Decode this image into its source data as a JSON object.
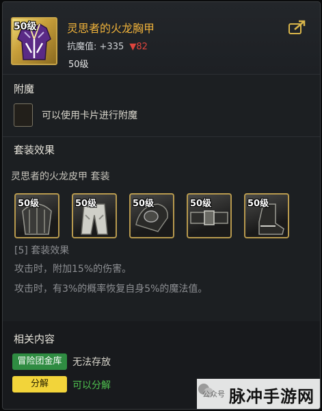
{
  "item": {
    "level_badge": "50级",
    "name": "灵思者的火龙胸甲",
    "stat_label": "抗魔值:",
    "stat_value": "+335",
    "stat_change": "▼82",
    "level": "50级"
  },
  "enchant": {
    "title": "附魔",
    "text": "可以使用卡片进行附魔"
  },
  "set": {
    "title": "套装效果",
    "name": "灵思者的火龙皮甲  套装",
    "pieces": [
      {
        "level": "50级",
        "icon": "helmet-icon"
      },
      {
        "level": "50级",
        "icon": "pants-icon"
      },
      {
        "level": "50级",
        "icon": "shoulder-icon"
      },
      {
        "level": "50级",
        "icon": "belt-icon"
      },
      {
        "level": "50级",
        "icon": "boots-icon"
      }
    ],
    "effect_header": "[5] 套装效果",
    "effects": [
      "攻击时，附加15%的伤害。",
      "攻击时，有3%的概率恢复自身5%的魔法值。"
    ]
  },
  "related": {
    "title": "相关内容",
    "rows": [
      {
        "tag": "冒险团金库",
        "text": "无法存放",
        "tag_color": "#2f8c42",
        "text_color": "#d9d6cc"
      },
      {
        "tag": "分解",
        "text": "可以分解",
        "tag_color": "#f2d43a",
        "text_color": "#4fc24f"
      }
    ]
  },
  "watermark": {
    "small": "公众号",
    "big": "脉冲手游网"
  },
  "colors": {
    "item_name": "#f0b23a",
    "stat_down": "#e0453d",
    "frame_gold": "#b89a4e"
  }
}
